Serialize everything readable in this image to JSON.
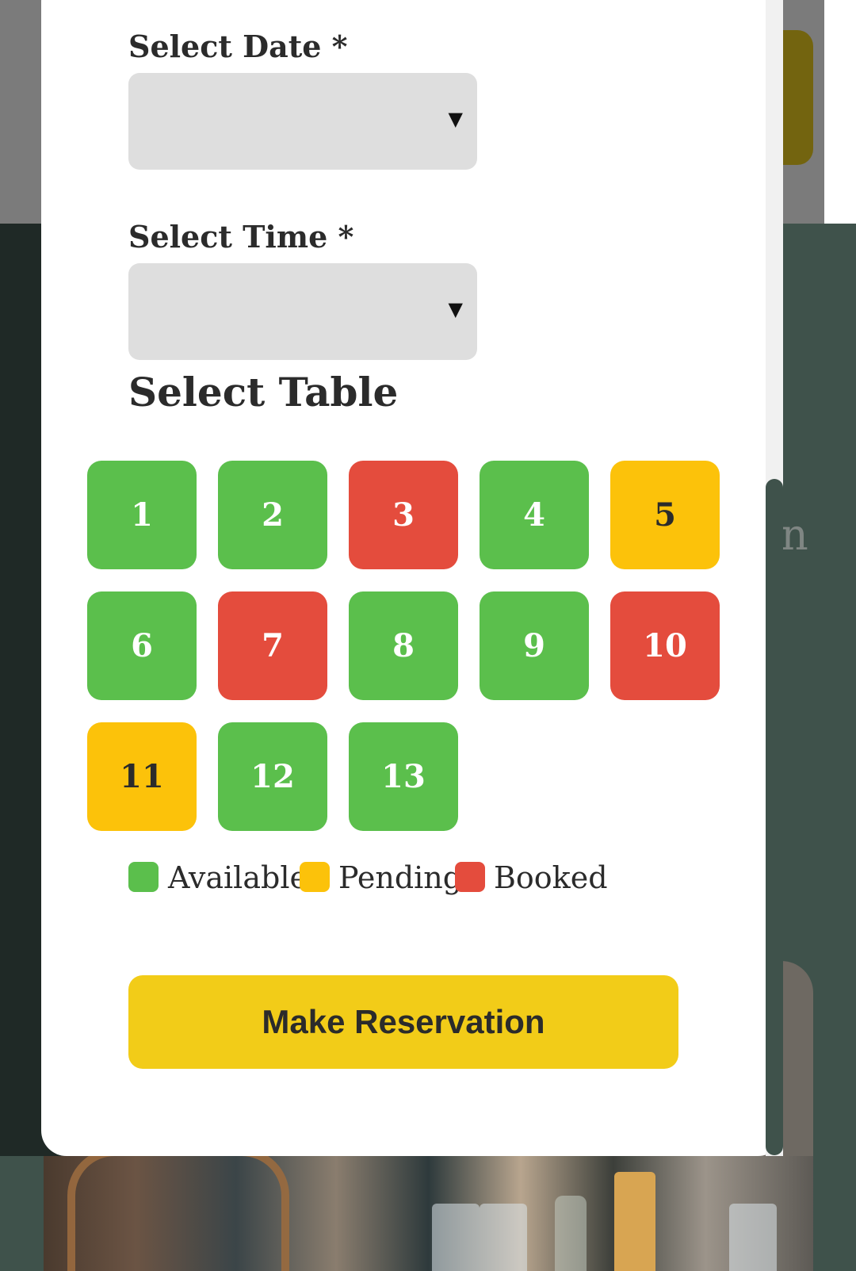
{
  "form": {
    "date_label": "Select Date *",
    "date_value": "",
    "time_label": "Select Time *",
    "time_value": "",
    "dropdown_arrow": "▼"
  },
  "tables": {
    "title": "Select Table",
    "items": [
      {
        "number": "1",
        "status": "available"
      },
      {
        "number": "2",
        "status": "available"
      },
      {
        "number": "3",
        "status": "booked"
      },
      {
        "number": "4",
        "status": "available"
      },
      {
        "number": "5",
        "status": "pending"
      },
      {
        "number": "6",
        "status": "available"
      },
      {
        "number": "7",
        "status": "booked"
      },
      {
        "number": "8",
        "status": "available"
      },
      {
        "number": "9",
        "status": "available"
      },
      {
        "number": "10",
        "status": "booked"
      },
      {
        "number": "11",
        "status": "pending"
      },
      {
        "number": "12",
        "status": "available"
      },
      {
        "number": "13",
        "status": "available"
      }
    ]
  },
  "legend": {
    "available": "Available",
    "pending": "Pending",
    "booked": "Booked"
  },
  "colors": {
    "available": "#5bbf4c",
    "pending": "#fcc20a",
    "booked": "#e44c3d",
    "cta": "#f2cc18",
    "scrollbar_thumb": "#3f524b"
  },
  "actions": {
    "submit_label": "Make Reservation"
  },
  "background": {
    "partial_letter": "n"
  }
}
